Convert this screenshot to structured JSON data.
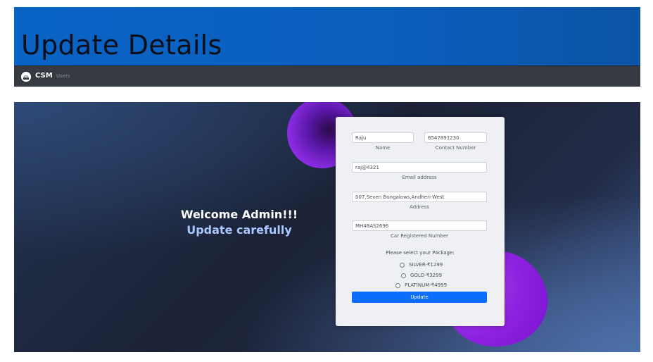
{
  "slide": {
    "title": "Update Details"
  },
  "navbar": {
    "brand": "CSM",
    "links": [
      "Users"
    ]
  },
  "hero": {
    "welcome": "Welcome Admin!!!",
    "subtitle": "Update carefully"
  },
  "form": {
    "name": {
      "value": "Raju",
      "label": "Name"
    },
    "contact": {
      "value": "6547891230",
      "label": "Contact Number"
    },
    "email": {
      "value": "raj@4321",
      "label": "Email address"
    },
    "address": {
      "value": "007,Seven Bungalows,Andheri-West",
      "label": "Address"
    },
    "car": {
      "value": "MH48AS2696",
      "label": "Car Registered Number"
    },
    "package_prompt": "Please select your Package:",
    "packages": [
      "SILVER-₹1299",
      "GOLD-₹3299",
      "PLATINUM-₹4999"
    ],
    "submit_label": "Update"
  },
  "colors": {
    "navbar": "#343a40",
    "button": "#0d6efd",
    "accent_blob": "#8a2be2",
    "title_band": "#0a64c6"
  }
}
